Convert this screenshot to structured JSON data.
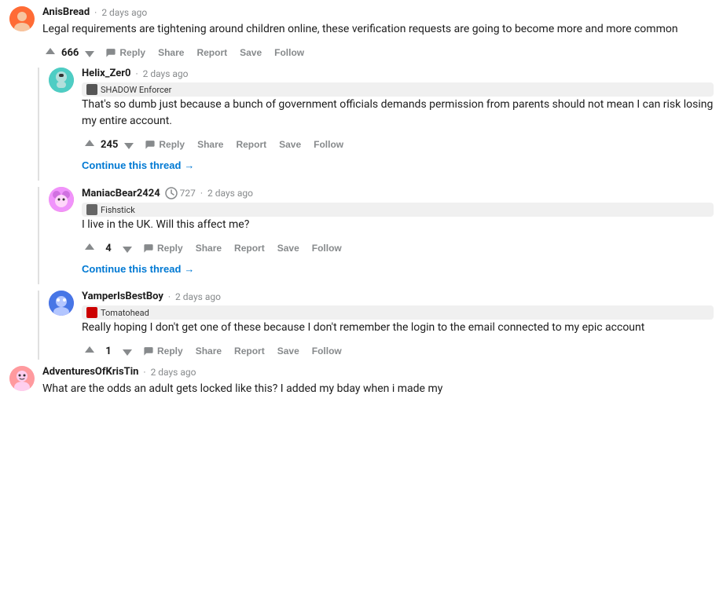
{
  "comments": [
    {
      "id": "anisbread",
      "username": "AnisBread",
      "timestamp": "2 days ago",
      "flair": null,
      "karma": null,
      "text": "Legal requirements are tightening around children online, these verification requests are going to become more and more common",
      "upvotes": "666",
      "actions": [
        "Reply",
        "Share",
        "Report",
        "Save",
        "Follow"
      ],
      "avatar_color": "av-anisbread",
      "indent": 0
    },
    {
      "id": "helixzer0",
      "username": "Helix_Zer0",
      "timestamp": "2 days ago",
      "flair": "SHADOW Enforcer",
      "karma": null,
      "text": "That's so dumb just because a bunch of government officials demands permission from parents should not mean I can risk losing my entire account.",
      "upvotes": "245",
      "actions": [
        "Reply",
        "Share",
        "Report",
        "Save",
        "Follow"
      ],
      "avatar_color": "av-helixzer0",
      "indent": 1,
      "continue_thread": true
    },
    {
      "id": "maniacbear",
      "username": "ManiacBear2424",
      "timestamp": "2 days ago",
      "flair": "Fishstick",
      "karma": "727",
      "text": "I live in the UK. Will this affect me?",
      "upvotes": "4",
      "actions": [
        "Reply",
        "Share",
        "Report",
        "Save",
        "Follow"
      ],
      "avatar_color": "av-maniacbear",
      "indent": 1,
      "continue_thread": true
    },
    {
      "id": "yamper",
      "username": "YamperIsBestBoy",
      "timestamp": "2 days ago",
      "flair": "Tomatohead",
      "karma": null,
      "text": "Really hoping I don't get one of these because I don't remember the login to the email connected to my epic account",
      "upvotes": "1",
      "actions": [
        "Reply",
        "Share",
        "Report",
        "Save",
        "Follow"
      ],
      "avatar_color": "av-yamper",
      "indent": 1,
      "continue_thread": false
    },
    {
      "id": "adventurekris",
      "username": "AdventuresOfKrisTin",
      "timestamp": "2 days ago",
      "flair": null,
      "karma": null,
      "text": "What are the odds an adult gets locked like this? I added my bday when i made my",
      "upvotes": null,
      "actions": [],
      "avatar_color": "av-adventurekris",
      "indent": 0,
      "continue_thread": false
    }
  ],
  "labels": {
    "reply": "Reply",
    "share": "Share",
    "report": "Report",
    "save": "Save",
    "follow": "Follow",
    "continue_thread": "Continue this thread"
  }
}
